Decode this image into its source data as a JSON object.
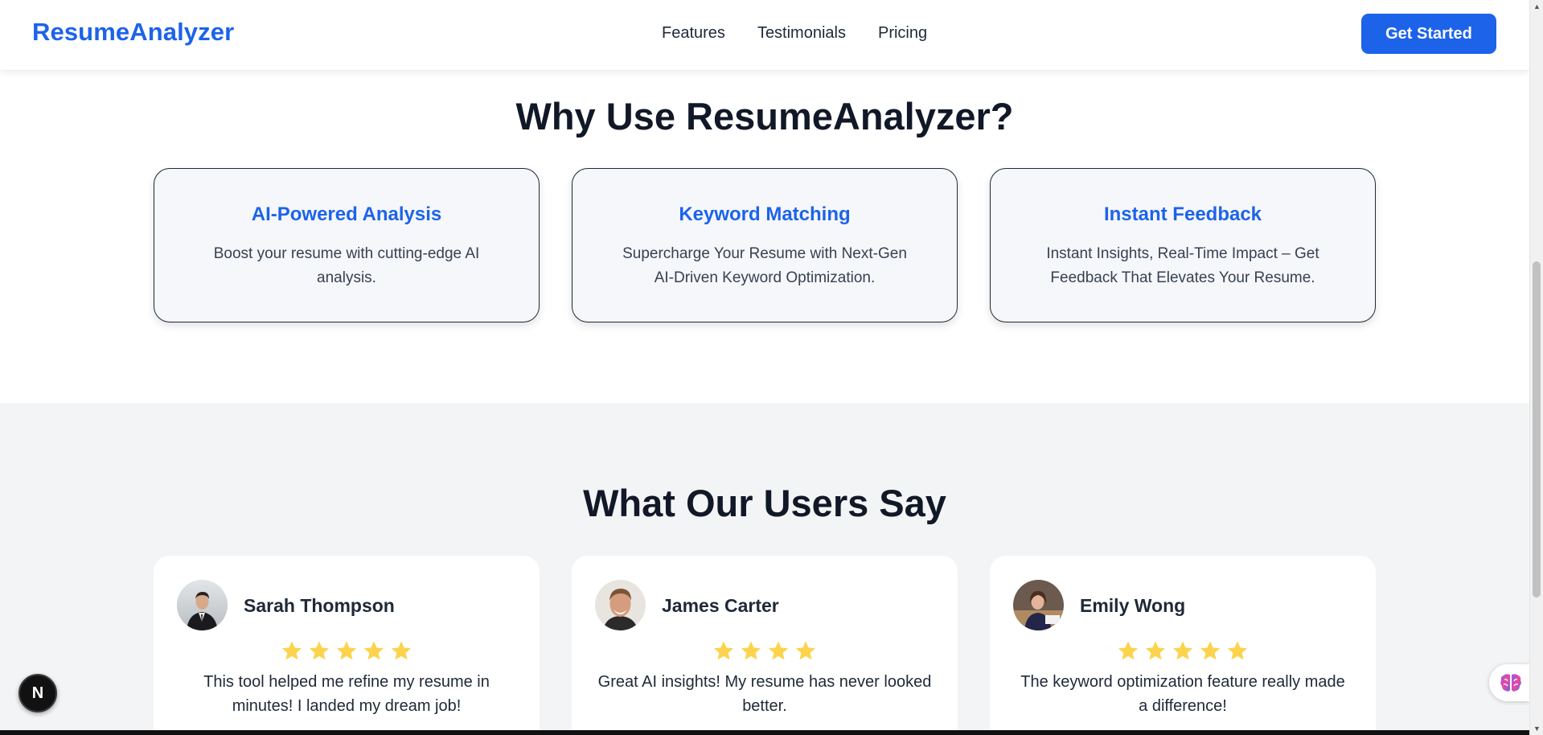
{
  "header": {
    "logo": "ResumeAnalyzer",
    "nav": [
      "Features",
      "Testimonials",
      "Pricing"
    ],
    "cta_label": "Get Started",
    "accent_color": "#1d63ea"
  },
  "features": {
    "title": "Why Use ResumeAnalyzer?",
    "cards": [
      {
        "title": "AI-Powered Analysis",
        "line1": "Boost your resume with cutting-edge AI",
        "line2": "analysis."
      },
      {
        "title": "Keyword Matching",
        "line1": "Supercharge Your Resume with Next-Gen",
        "line2": "AI-Driven Keyword Optimization."
      },
      {
        "title": "Instant Feedback",
        "line1": "Instant Insights, Real-Time Impact – Get",
        "line2": "Feedback That Elevates Your Resume."
      }
    ]
  },
  "testimonials": {
    "title": "What Our Users Say",
    "items": [
      {
        "name": "Sarah Thompson",
        "rating": 5,
        "line1": "This tool helped me refine my resume in",
        "line2": "minutes! I landed my dream job!"
      },
      {
        "name": "James Carter",
        "rating": 4,
        "line1": "Great AI insights! My resume has never looked",
        "line2": "better."
      },
      {
        "name": "Emily Wong",
        "rating": 5,
        "line1": "The keyword optimization feature really made",
        "line2": "a difference!"
      }
    ],
    "star_color": "#fcd34d"
  },
  "floating": {
    "next_badge": "N",
    "widget_icon": "brain-icon"
  }
}
